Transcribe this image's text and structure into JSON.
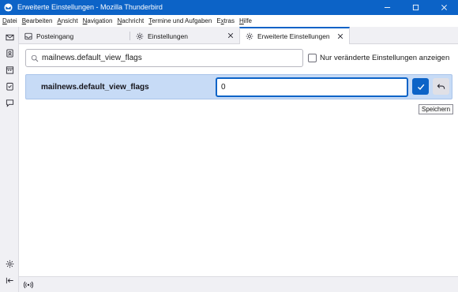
{
  "window": {
    "title": "Erweiterte Einstellungen - Mozilla Thunderbird",
    "app_icon": "thunderbird-icon",
    "controls": [
      "minimize-icon",
      "maximize-icon",
      "close-icon"
    ]
  },
  "menubar": {
    "items": [
      {
        "mn": "D",
        "rest": "atei"
      },
      {
        "mn": "B",
        "rest": "earbeiten"
      },
      {
        "mn": "A",
        "rest": "nsicht"
      },
      {
        "mn": "N",
        "rest": "avigation"
      },
      {
        "mn": "N",
        "rest": "achricht"
      },
      {
        "mn": "T",
        "rest": "ermine und Aufgaben"
      },
      {
        "pre": "E",
        "mn": "x",
        "rest": "tras"
      },
      {
        "mn": "H",
        "rest": "ilfe"
      }
    ]
  },
  "spaces": {
    "top": [
      "mail-icon",
      "address-book-icon",
      "calendar-icon",
      "tasks-icon",
      "chat-icon"
    ],
    "bottom": [
      "settings-gear-icon",
      "collapse-sidebar-icon"
    ]
  },
  "tabs": [
    {
      "label": "Posteingang",
      "icon": "inbox-icon",
      "active": false
    },
    {
      "label": "Einstellungen",
      "icon": "gear-icon",
      "active": false
    },
    {
      "label": "Erweiterte Einstellungen",
      "icon": "gear-icon",
      "active": true
    }
  ],
  "search": {
    "value": "mailnews.default_view_flags",
    "icon": "search-icon"
  },
  "modified_only": {
    "label": "Nur veränderte Einstellungen anzeigen",
    "checked": false
  },
  "pref": {
    "name": "mailnews.default_view_flags",
    "value": "0"
  },
  "tooltip": {
    "text": "Speichern"
  },
  "statusbar": {
    "icon": "online-status-icon"
  },
  "colors": {
    "accent": "#0c63c7",
    "row_highlight": "#c7dbf6"
  }
}
